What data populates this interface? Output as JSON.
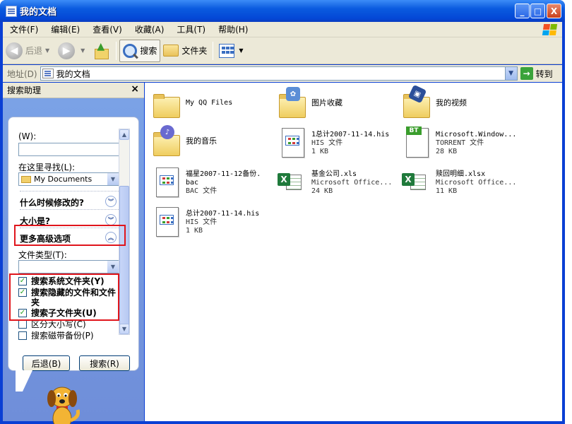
{
  "window": {
    "title": "我的文档",
    "controls": {
      "minimize": "_",
      "maximize": "□",
      "close": "X"
    }
  },
  "menu": [
    {
      "label": "文件(F)"
    },
    {
      "label": "编辑(E)"
    },
    {
      "label": "查看(V)"
    },
    {
      "label": "收藏(A)"
    },
    {
      "label": "工具(T)"
    },
    {
      "label": "帮助(H)"
    }
  ],
  "toolbar": {
    "back_label": "后退",
    "search_label": "搜索",
    "folders_label": "文件夹"
  },
  "address": {
    "label": "地址(D)",
    "value": "我的文档",
    "go_label": "转到"
  },
  "search_pane": {
    "title": "搜索助理",
    "field_label": "(W):",
    "look_in_label": "在这里寻找(L):",
    "look_in_value": "My Documents",
    "when_modified": "什么时候修改的?",
    "size_label": "大小是?",
    "advanced_label": "更多高级选项",
    "file_type_label": "文件类型(T):",
    "checkboxes": [
      {
        "label": "搜索系统文件夹(Y)",
        "checked": true
      },
      {
        "label": "搜索隐藏的文件和文件夹",
        "checked": true
      },
      {
        "label": "搜索子文件夹(U)",
        "checked": true
      },
      {
        "label": "区分大小写(C)",
        "checked": false
      },
      {
        "label": "搜索磁带备份(P)",
        "checked": false
      }
    ],
    "back_button": "后退(B)",
    "search_button": "搜索(R)"
  },
  "files": [
    {
      "name": "My QQ Files",
      "type": "",
      "size": "",
      "icon": "folder-icon"
    },
    {
      "name": "图片收藏",
      "type": "",
      "size": "",
      "icon": "pictures-folder-icon"
    },
    {
      "name": "我的视频",
      "type": "",
      "size": "",
      "icon": "video-folder-icon"
    },
    {
      "name": "我的音乐",
      "type": "",
      "size": "",
      "icon": "music-folder-icon"
    },
    {
      "name": "1总计2007-11-14.his",
      "type": "HIS 文件",
      "size": "1 KB",
      "icon": "file-icon"
    },
    {
      "name": "Microsoft.Window...",
      "type": "TORRENT 文件",
      "size": "28 KB",
      "icon": "torrent-icon"
    },
    {
      "name": "福星2007-11-12备份.",
      "name2": "bac",
      "type": "BAC 文件",
      "size": "",
      "icon": "file-icon"
    },
    {
      "name": "基金公司.xls",
      "type": "Microsoft Office...",
      "size": "24 KB",
      "icon": "excel-icon"
    },
    {
      "name": "赎回明细.xlsx",
      "type": "Microsoft Office...",
      "size": "11 KB",
      "icon": "excel-icon"
    },
    {
      "name": "总计2007-11-14.his",
      "type": "HIS 文件",
      "size": "1 KB",
      "icon": "file-icon"
    }
  ]
}
